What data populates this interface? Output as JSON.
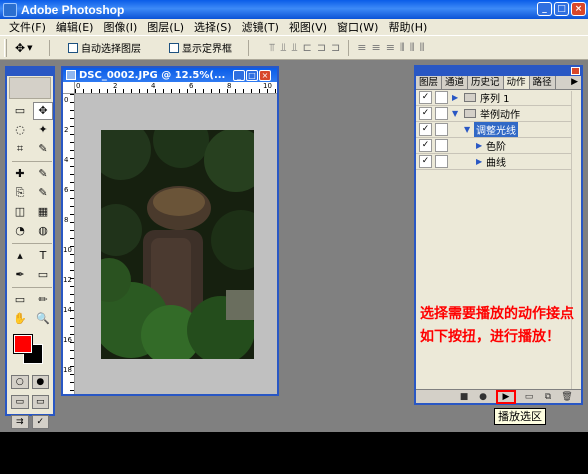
{
  "window": {
    "title": "Adobe Photoshop",
    "buttons": {
      "minimize": "_",
      "maximize": "□",
      "close": "×"
    }
  },
  "menu": [
    "文件(F)",
    "编辑(E)",
    "图像(I)",
    "图层(L)",
    "选择(S)",
    "滤镜(T)",
    "视图(V)",
    "窗口(W)",
    "帮助(H)"
  ],
  "options": {
    "auto_select": "自动选择图层",
    "show_bounds": "显示定界框"
  },
  "toolbox": {
    "tools": [
      "▭",
      "✥",
      "◌",
      "✦",
      "⌗",
      "✎",
      "✚",
      "✎",
      "⎘",
      "✎",
      "◫",
      "▦",
      "◔",
      "◍",
      "▴",
      "T",
      "✒",
      "▭",
      "▭",
      "✏",
      "✋",
      "🔍"
    ],
    "colors": {
      "foreground": "#ff0000",
      "background": "#000000"
    }
  },
  "document": {
    "title": "DSC_0002.JPG @ 12.5%(...",
    "ruler_top_nums": [
      "0",
      "2",
      "4",
      "6",
      "8",
      "10"
    ],
    "ruler_left_nums": [
      "0",
      "2",
      "4",
      "6",
      "8",
      "10",
      "12",
      "14",
      "16",
      "18"
    ]
  },
  "panel": {
    "tabs": [
      "图层",
      "通道",
      "历史记",
      "动作",
      "路径"
    ],
    "active_tab": "动作",
    "actions": [
      {
        "label": "序列 1",
        "checked": true,
        "level": 0,
        "expanded": false,
        "folder": true
      },
      {
        "label": "举例动作",
        "checked": true,
        "level": 0,
        "expanded": true,
        "folder": true
      },
      {
        "label": "调整光线",
        "checked": true,
        "level": 1,
        "expanded": true,
        "selected": true
      },
      {
        "label": "色阶",
        "checked": true,
        "level": 2,
        "expanded": false
      },
      {
        "label": "曲线",
        "checked": true,
        "level": 2,
        "expanded": false
      }
    ],
    "annotation": "选择需要播放的动作接点如下按扭，进行播放！",
    "buttons": [
      "stop",
      "record",
      "play",
      "new-set",
      "new-action",
      "delete"
    ]
  },
  "tooltip": "播放选区"
}
